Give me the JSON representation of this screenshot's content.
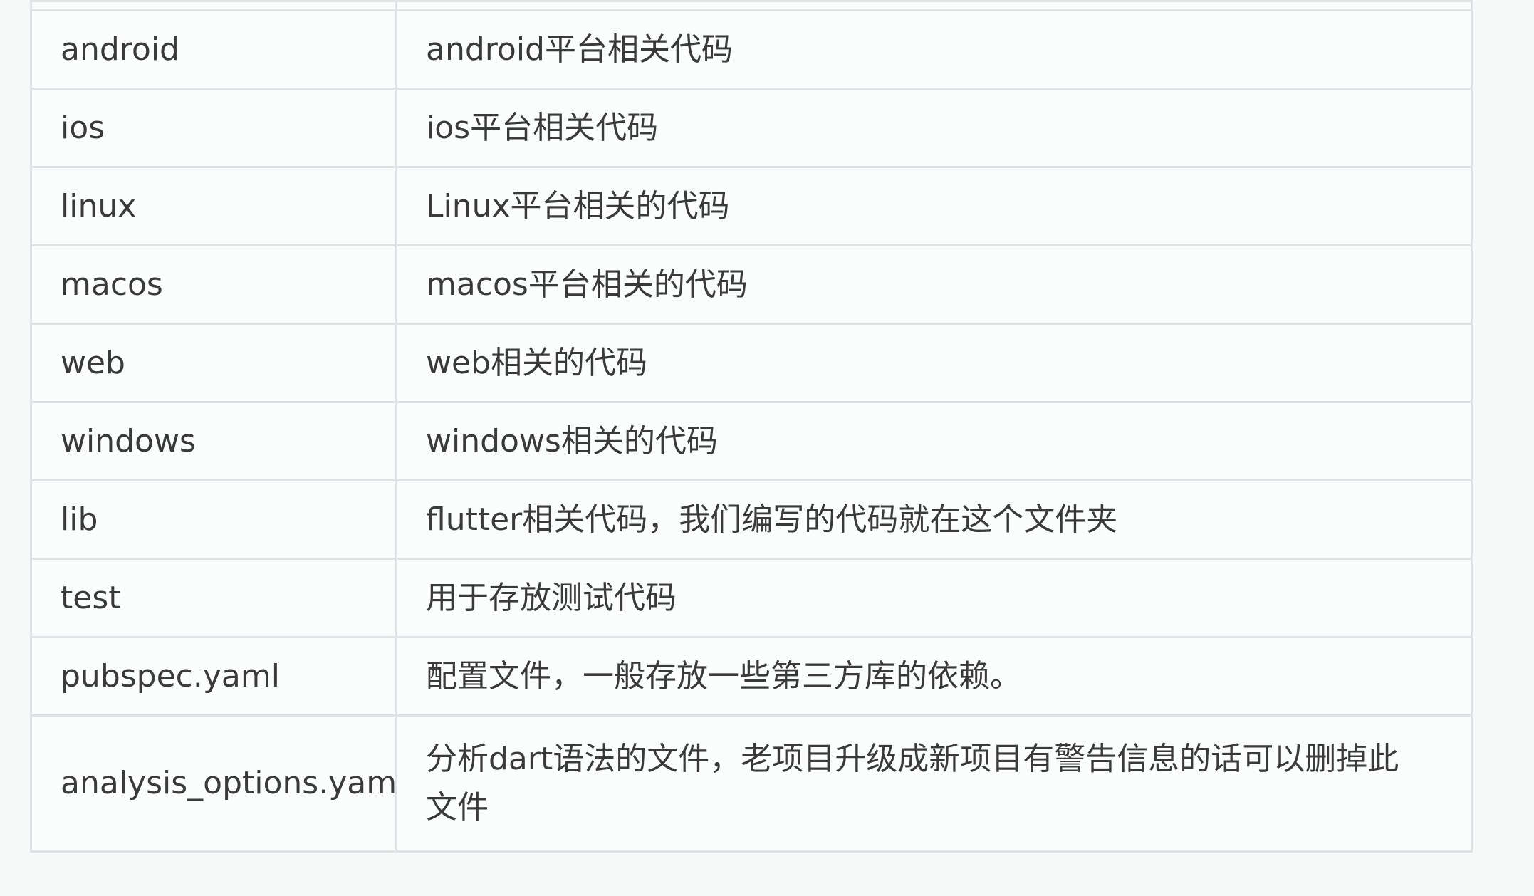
{
  "table": {
    "rows": [
      {
        "name": "android",
        "desc": "android平台相关代码"
      },
      {
        "name": "ios",
        "desc": "ios平台相关代码"
      },
      {
        "name": "linux",
        "desc": "Linux平台相关的代码"
      },
      {
        "name": "macos",
        "desc": "macos平台相关的代码"
      },
      {
        "name": "web",
        "desc": "web相关的代码"
      },
      {
        "name": "windows",
        "desc": "windows相关的代码"
      },
      {
        "name": "lib",
        "desc": "flutter相关代码，我们编写的代码就在这个文件夹"
      },
      {
        "name": "test",
        "desc": "用于存放测试代码"
      },
      {
        "name": "pubspec.yaml",
        "desc": "配置文件，一般存放一些第三方库的依赖。"
      },
      {
        "name": "analysis_options.yaml",
        "desc": "分析dart语法的文件，老项目升级成新项目有警告信息的话可以删掉此文件"
      }
    ]
  }
}
